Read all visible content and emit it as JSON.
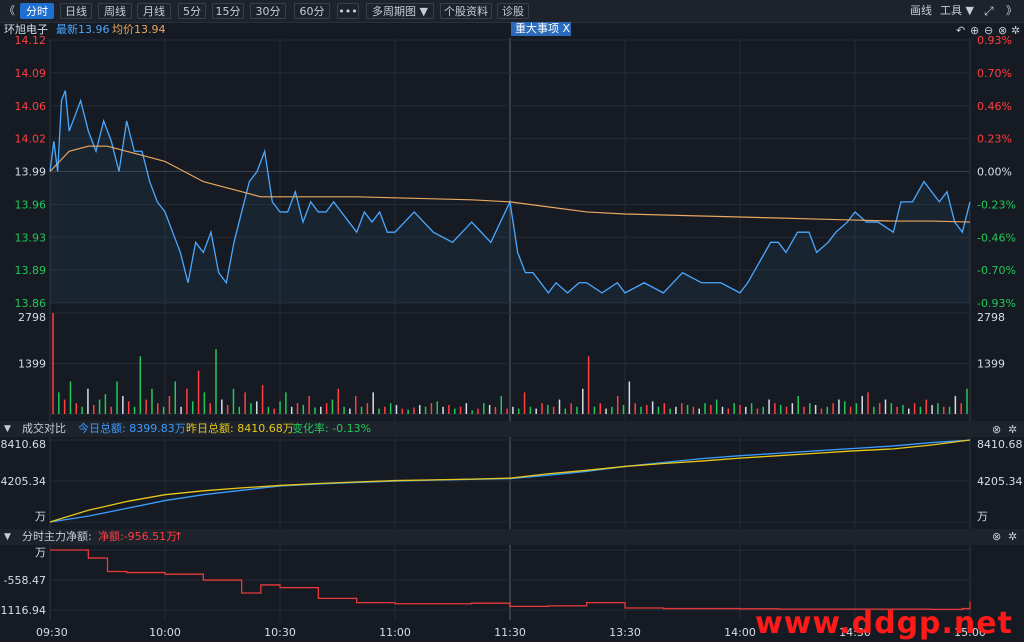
{
  "toolbar": {
    "back": "《",
    "forward": "》",
    "periods": [
      "分时",
      "日线",
      "周线",
      "月线",
      "5分",
      "15分",
      "30分",
      "60分",
      "•••",
      "多周期图 ▼",
      "个股资料",
      "诊股"
    ],
    "draw_label": "画线",
    "tools_label": "工具 ▼"
  },
  "info": {
    "stock_name": "环旭电子",
    "latest_label": "最新13.96",
    "avg_label": "均价13.94",
    "events_tag": "重大事项 X"
  },
  "colors": {
    "up": "#ff4040",
    "down": "#22c85a",
    "neutral": "#d8dce4",
    "price_line": "#4aa8ff",
    "avg_line": "#e8a860",
    "today_turnover": "#3a9cff",
    "yesterday_turnover": "#e8c81a",
    "net_flow": "#e83a3a"
  },
  "price_axis": {
    "left_ticks": [
      "14.12",
      "14.09",
      "14.06",
      "14.02",
      "13.99",
      "13.96",
      "13.93",
      "13.89",
      "13.86"
    ],
    "right_ticks": [
      "0.93%",
      "0.70%",
      "0.46%",
      "0.23%",
      "0.00%",
      "-0.23%",
      "-0.46%",
      "-0.70%",
      "-0.93%"
    ]
  },
  "volume_axis": {
    "ticks": [
      "2798",
      "1399"
    ]
  },
  "turnover": {
    "title": "成交对比",
    "today_label": "今日总额: 8399.83万",
    "yesterday_label": "昨日总额: 8410.68万",
    "change_label": "变化率: -0.13%",
    "ticks": [
      "8410.68",
      "4205.34",
      "万"
    ]
  },
  "flow": {
    "title": "分时主力净额:",
    "net_label": "净额:-956.51万",
    "net_arrow": "↑",
    "ticks": [
      "万",
      "-558.47",
      "-1116.94"
    ]
  },
  "time_axis": [
    "09:30",
    "10:00",
    "10:30",
    "11:00",
    "11:30",
    "13:30",
    "14:00",
    "14:30",
    "15:00"
  ],
  "watermark": "www.ddgp.net",
  "chart_data": [
    {
      "type": "line",
      "name": "price",
      "x": [
        "09:30",
        "09:31",
        "09:32",
        "09:33",
        "09:34",
        "09:35",
        "09:36",
        "09:38",
        "09:40",
        "09:42",
        "09:44",
        "09:46",
        "09:48",
        "09:50",
        "09:52",
        "09:54",
        "09:56",
        "09:58",
        "10:00",
        "10:02",
        "10:04",
        "10:06",
        "10:08",
        "10:10",
        "10:12",
        "10:14",
        "10:16",
        "10:18",
        "10:20",
        "10:22",
        "10:24",
        "10:26",
        "10:28",
        "10:30",
        "10:32",
        "10:34",
        "10:36",
        "10:38",
        "10:40",
        "10:42",
        "10:44",
        "10:46",
        "10:48",
        "10:50",
        "10:52",
        "10:54",
        "10:56",
        "10:58",
        "11:00",
        "11:05",
        "11:10",
        "11:15",
        "11:20",
        "11:25",
        "11:30",
        "13:02",
        "13:04",
        "13:06",
        "13:08",
        "13:10",
        "13:12",
        "13:15",
        "13:18",
        "13:20",
        "13:24",
        "13:28",
        "13:30",
        "13:35",
        "13:40",
        "13:45",
        "13:50",
        "13:55",
        "14:00",
        "14:02",
        "14:05",
        "14:08",
        "14:10",
        "14:12",
        "14:15",
        "14:18",
        "14:20",
        "14:23",
        "14:25",
        "14:28",
        "14:30",
        "14:33",
        "14:36",
        "14:40",
        "14:42",
        "14:45",
        "14:48",
        "14:50",
        "14:52",
        "14:54",
        "14:56",
        "14:58",
        "15:00"
      ],
      "y": [
        13.99,
        14.02,
        13.99,
        14.06,
        14.07,
        14.03,
        14.04,
        14.06,
        14.03,
        14.01,
        14.04,
        14.02,
        13.99,
        14.04,
        14.01,
        14.01,
        13.98,
        13.96,
        13.95,
        13.93,
        13.91,
        13.88,
        13.92,
        13.91,
        13.93,
        13.89,
        13.88,
        13.92,
        13.95,
        13.98,
        13.99,
        14.01,
        13.96,
        13.95,
        13.95,
        13.97,
        13.94,
        13.96,
        13.95,
        13.95,
        13.96,
        13.95,
        13.94,
        13.93,
        13.95,
        13.94,
        13.95,
        13.93,
        13.93,
        13.95,
        13.93,
        13.92,
        13.94,
        13.92,
        13.96,
        13.91,
        13.89,
        13.89,
        13.88,
        13.87,
        13.88,
        13.87,
        13.88,
        13.88,
        13.87,
        13.88,
        13.87,
        13.88,
        13.87,
        13.89,
        13.88,
        13.88,
        13.87,
        13.88,
        13.9,
        13.92,
        13.92,
        13.91,
        13.93,
        13.93,
        13.91,
        13.92,
        13.93,
        13.94,
        13.95,
        13.94,
        13.94,
        13.93,
        13.96,
        13.96,
        13.98,
        13.97,
        13.96,
        13.97,
        13.94,
        13.93,
        13.96
      ],
      "ylim": [
        13.86,
        14.12
      ]
    },
    {
      "type": "line",
      "name": "avg",
      "x": [
        "09:30",
        "09:35",
        "09:40",
        "09:45",
        "09:50",
        "09:55",
        "10:00",
        "10:05",
        "10:10",
        "10:15",
        "10:20",
        "10:25",
        "10:30",
        "10:40",
        "10:50",
        "11:00",
        "11:10",
        "11:20",
        "11:30",
        "13:10",
        "13:20",
        "13:30",
        "13:40",
        "13:50",
        "14:00",
        "14:10",
        "14:20",
        "14:30",
        "14:40",
        "14:50",
        "15:00"
      ],
      "y": [
        13.99,
        14.01,
        14.015,
        14.015,
        14.01,
        14.005,
        14.0,
        13.99,
        13.98,
        13.975,
        13.97,
        13.965,
        13.965,
        13.965,
        13.965,
        13.964,
        13.963,
        13.962,
        13.96,
        13.955,
        13.95,
        13.948,
        13.947,
        13.946,
        13.945,
        13.944,
        13.943,
        13.942,
        13.941,
        13.941,
        13.94
      ]
    },
    {
      "type": "bar",
      "name": "volume",
      "ylim": [
        0,
        2798
      ],
      "values": [
        2798,
        600,
        400,
        900,
        300,
        200,
        700,
        250,
        400,
        550,
        200,
        900,
        500,
        350,
        200,
        1600,
        400,
        700,
        300,
        200,
        500,
        900,
        200,
        700,
        350,
        1200,
        600,
        300,
        1800,
        400,
        250,
        700,
        200,
        600,
        300,
        350,
        800,
        200,
        150,
        350,
        600,
        200,
        300,
        250,
        500,
        180,
        200,
        300,
        400,
        700,
        200,
        150,
        500,
        200,
        300,
        600,
        150,
        200,
        300,
        250,
        150,
        120,
        180,
        250,
        200,
        300,
        350,
        200,
        250,
        150,
        200,
        300,
        100,
        150,
        300,
        250,
        200,
        500,
        150,
        200,
        150,
        600,
        200,
        150,
        300,
        250,
        200,
        400,
        150,
        300,
        200,
        700,
        1600,
        200,
        300,
        150,
        200,
        500,
        250,
        900,
        300,
        200,
        250,
        350,
        200,
        300,
        150,
        200,
        300,
        250,
        200,
        150,
        300,
        250,
        400,
        200,
        150,
        300,
        250,
        200,
        300,
        150,
        200,
        400,
        300,
        250,
        200,
        300,
        500,
        200,
        300,
        250,
        150,
        200,
        300,
        400,
        350,
        200,
        300,
        500,
        600,
        200,
        300,
        400,
        300,
        200,
        250,
        150,
        300,
        200,
        400,
        250,
        300,
        200,
        200,
        500,
        300,
        700
      ],
      "directions": [
        "up",
        "down",
        "up",
        "down",
        "up",
        "down",
        "neutral",
        "up",
        "down",
        "down",
        "up",
        "down",
        "neutral",
        "up",
        "down",
        "down",
        "up",
        "down",
        "up",
        "down",
        "up",
        "down",
        "neutral",
        "up",
        "down",
        "up",
        "down",
        "up",
        "down",
        "neutral",
        "up",
        "down",
        "down",
        "up",
        "down",
        "neutral",
        "up",
        "down",
        "up",
        "down",
        "down",
        "neutral",
        "up",
        "down",
        "up",
        "down",
        "neutral",
        "up",
        "down",
        "up",
        "down",
        "neutral",
        "up",
        "down",
        "up",
        "neutral",
        "down",
        "up",
        "down",
        "neutral",
        "up",
        "down",
        "up",
        "neutral",
        "down",
        "up",
        "down",
        "neutral",
        "up",
        "down",
        "up",
        "neutral",
        "down",
        "up",
        "down",
        "neutral",
        "up",
        "down",
        "up",
        "neutral",
        "down",
        "up",
        "down",
        "neutral",
        "up",
        "down",
        "up",
        "neutral",
        "down",
        "up",
        "down",
        "neutral",
        "up",
        "down",
        "up",
        "neutral",
        "down",
        "up",
        "down",
        "neutral",
        "up",
        "down",
        "up",
        "neutral",
        "down",
        "up",
        "down",
        "neutral",
        "up",
        "down",
        "up",
        "neutral",
        "down",
        "up",
        "down",
        "neutral",
        "up",
        "down",
        "up",
        "neutral",
        "down",
        "up",
        "down",
        "neutral",
        "up",
        "down",
        "up",
        "neutral",
        "down",
        "up",
        "down",
        "neutral",
        "up",
        "down",
        "up",
        "neutral",
        "down",
        "up",
        "down",
        "neutral",
        "up",
        "down",
        "up",
        "neutral",
        "down",
        "up",
        "down",
        "neutral",
        "up",
        "down",
        "up",
        "neutral",
        "down",
        "up",
        "down",
        "neutral",
        "up",
        "down",
        "up",
        "neutral",
        "down",
        "up"
      ]
    },
    {
      "type": "line",
      "name": "turnover",
      "ylim": [
        0,
        8410.68
      ],
      "x": [
        "09:30",
        "09:40",
        "09:50",
        "10:00",
        "10:10",
        "10:20",
        "10:30",
        "10:40",
        "10:50",
        "11:00",
        "11:10",
        "11:20",
        "11:30",
        "13:10",
        "13:20",
        "13:30",
        "13:40",
        "13:50",
        "14:00",
        "14:10",
        "14:20",
        "14:30",
        "14:40",
        "14:50",
        "15:00"
      ],
      "series": [
        {
          "values": [
            0,
            600,
            1400,
            2200,
            2800,
            3250,
            3700,
            3900,
            4050,
            4200,
            4300,
            4380,
            4450,
            4800,
            5200,
            5700,
            6100,
            6500,
            6800,
            7050,
            7300,
            7550,
            7800,
            8150,
            8399.83
          ]
        },
        {
          "values": [
            0,
            1200,
            2100,
            2800,
            3200,
            3500,
            3750,
            3950,
            4100,
            4250,
            4320,
            4400,
            4500,
            4950,
            5300,
            5700,
            6000,
            6250,
            6550,
            6800,
            7050,
            7300,
            7500,
            7900,
            8410.68
          ]
        }
      ]
    },
    {
      "type": "line",
      "name": "net-flow",
      "ylim": [
        -1116.94,
        0
      ],
      "x": [
        "09:30",
        "09:35",
        "09:40",
        "09:45",
        "09:50",
        "10:00",
        "10:10",
        "10:20",
        "10:25",
        "10:30",
        "10:40",
        "10:50",
        "11:00",
        "11:10",
        "11:20",
        "11:30",
        "13:10",
        "13:20",
        "13:30",
        "13:40",
        "13:50",
        "14:00",
        "14:10",
        "14:20",
        "14:30",
        "14:40",
        "14:50",
        "14:58",
        "15:00"
      ],
      "series": [
        {
          "values": [
            0,
            0,
            -150,
            -400,
            -420,
            -450,
            -560,
            -800,
            -650,
            -700,
            -900,
            -980,
            -1000,
            -1000,
            -990,
            -1050,
            -1040,
            -980,
            -1080,
            -1090,
            -1090,
            -1095,
            -1100,
            -1100,
            -1100,
            -1100,
            -1105,
            -1090,
            -956.51
          ]
        }
      ]
    }
  ]
}
